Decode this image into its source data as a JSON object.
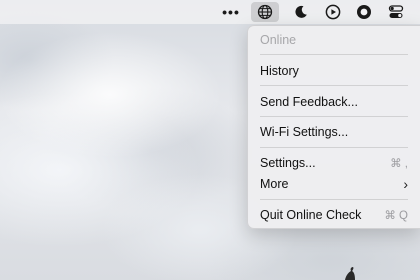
{
  "menubar": {
    "icons": [
      "more-icon",
      "globe-icon",
      "moon-icon",
      "play-icon",
      "record-icon",
      "control-center-icon"
    ],
    "more_label": "•••"
  },
  "menu": {
    "status": "Online",
    "items": [
      {
        "label": "History",
        "shortcut": ""
      },
      {
        "label": "Send Feedback...",
        "shortcut": ""
      },
      {
        "label": "Wi-Fi Settings...",
        "shortcut": ""
      },
      {
        "label": "Settings...",
        "shortcut": "⌘ ,"
      },
      {
        "label": "More",
        "shortcut": "›"
      },
      {
        "label": "Quit Online Check",
        "shortcut": "⌘ Q"
      }
    ]
  }
}
